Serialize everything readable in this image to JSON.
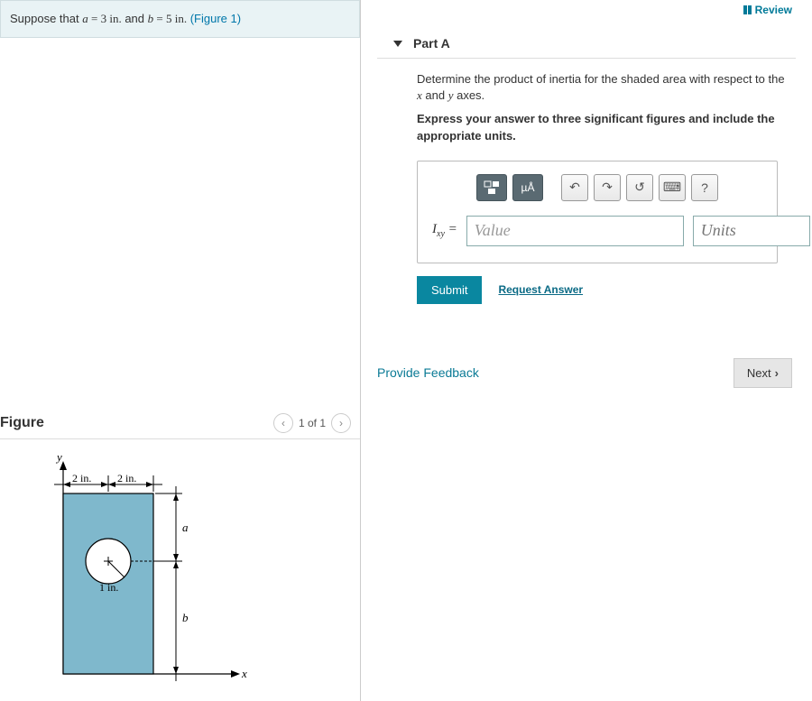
{
  "problem": {
    "prefix": "Suppose that ",
    "a_var": "a",
    "a_eq": " = 3 ",
    "a_unit": "in.",
    "mid": " and ",
    "b_var": "b",
    "b_eq": " = 5 ",
    "b_unit": "in.",
    "fig_link": "(Figure 1)"
  },
  "review_label": "Review",
  "part": {
    "title": "Part A",
    "instruction_pre": "Determine the product of inertia for the shaded area with respect to the ",
    "instruction_x": "x",
    "instruction_and": " and ",
    "instruction_y": "y",
    "instruction_post": " axes.",
    "instruction2": "Express your answer to three significant figures and include the appropriate units.",
    "answer_symbol": "I",
    "answer_sub": "xy",
    "answer_eq": " =",
    "value_placeholder": "Value",
    "units_placeholder": "Units",
    "toolbar": {
      "units_tool": "µÅ",
      "undo": "↶",
      "redo": "↷",
      "reset": "↺",
      "keyboard": "⌨",
      "help": "?"
    },
    "submit": "Submit",
    "request": "Request Answer"
  },
  "feedback": "Provide Feedback",
  "next": "Next",
  "figure": {
    "title": "Figure",
    "pager": "1 of 1",
    "labels": {
      "y": "y",
      "x": "x",
      "two_in_left": "2 in.",
      "two_in_right": "2 in.",
      "one_in": "1 in.",
      "a": "a",
      "b": "b"
    }
  }
}
